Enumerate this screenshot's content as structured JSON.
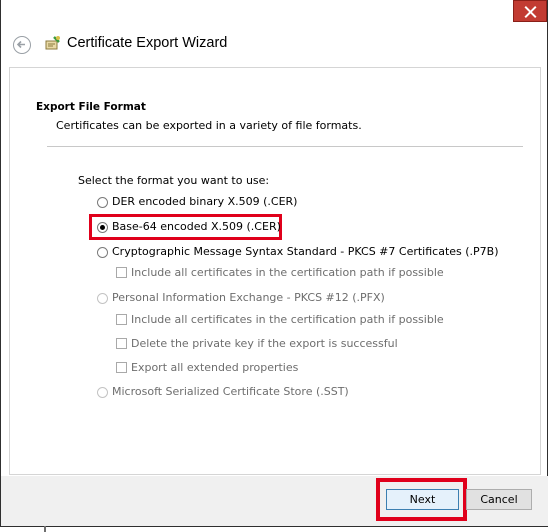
{
  "window": {
    "title": "Certificate Export Wizard"
  },
  "section": {
    "heading": "Export File Format",
    "description": "Certificates can be exported in a variety of file formats."
  },
  "format_prompt": "Select the format you want to use:",
  "options": {
    "der": {
      "label": "DER encoded binary X.509 (.CER)",
      "selected": false,
      "enabled": true
    },
    "base64": {
      "label": "Base-64 encoded X.509 (.CER)",
      "selected": true,
      "enabled": true
    },
    "pkcs7": {
      "label": "Cryptographic Message Syntax Standard - PKCS #7 Certificates (.P7B)",
      "selected": false,
      "enabled": true
    },
    "pkcs7_include_all": {
      "label": "Include all certificates in the certification path if possible",
      "checked": false,
      "enabled": false
    },
    "pfx": {
      "label": "Personal Information Exchange - PKCS #12 (.PFX)",
      "selected": false,
      "enabled": false
    },
    "pfx_include_all": {
      "label": "Include all certificates in the certification path if possible",
      "checked": false,
      "enabled": false
    },
    "pfx_delete_key": {
      "label": "Delete the private key if the export is successful",
      "checked": false,
      "enabled": false
    },
    "pfx_export_props": {
      "label": "Export all extended properties",
      "checked": false,
      "enabled": false
    },
    "sst": {
      "label": "Microsoft Serialized Certificate Store (.SST)",
      "selected": false,
      "enabled": false
    }
  },
  "buttons": {
    "next": "Next",
    "cancel": "Cancel"
  },
  "colors": {
    "highlight": "#e0001b",
    "close_button": "#c23b32"
  },
  "icons": {
    "back": "back-arrow-icon",
    "wizard": "certificate-wizard-icon",
    "close": "close-icon"
  }
}
